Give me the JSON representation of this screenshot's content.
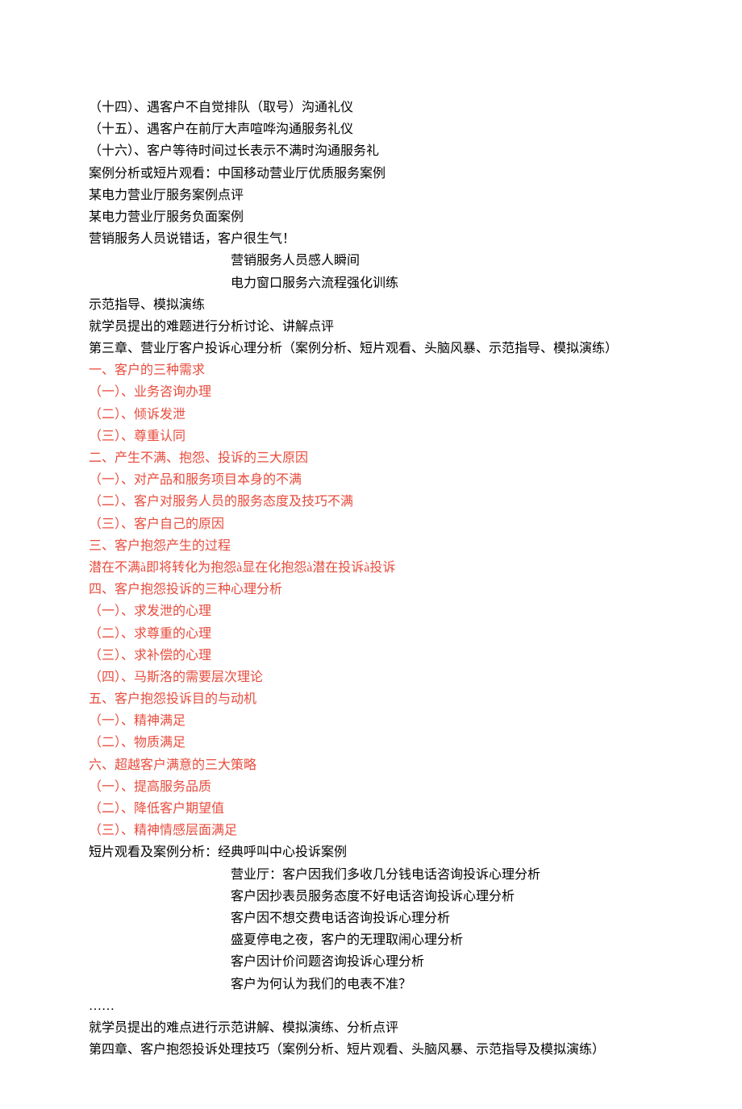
{
  "lines": [
    {
      "text": "（十四）、遇客户不自觉排队（取号）沟通礼仪",
      "color": "black"
    },
    {
      "text": "（十五）、遇客户在前厅大声喧哗沟通服务礼仪",
      "color": "black"
    },
    {
      "text": "（十六）、客户等待时间过长表示不满时沟通服务礼",
      "color": "black"
    },
    {
      "text": "案例分析或短片观看：中国移动营业厅优质服务案例",
      "color": "black"
    },
    {
      "text": "某电力营业厅服务案例点评",
      "color": "black"
    },
    {
      "text": "某电力营业厅服务负面案例",
      "color": "black"
    },
    {
      "text": "营销服务人员说错话，客户很生气！",
      "color": "black"
    },
    {
      "text": "营销服务人员感人瞬间",
      "color": "black",
      "indent": true
    },
    {
      "text": "电力窗口服务六流程强化训练",
      "color": "black",
      "indent": true
    },
    {
      "text": "示范指导、模拟演练",
      "color": "black"
    },
    {
      "text": "就学员提出的难题进行分析讨论、讲解点评",
      "color": "black"
    },
    {
      "text": "第三章、营业厅客户投诉心理分析（案例分析、短片观看、头脑风暴、示范指导、模拟演练）",
      "color": "black"
    },
    {
      "text": "一、客户的三种需求",
      "color": "red"
    },
    {
      "text": "（一）、业务咨询办理",
      "color": "red"
    },
    {
      "text": "（二）、倾诉发泄",
      "color": "red"
    },
    {
      "text": "（三）、尊重认同",
      "color": "red"
    },
    {
      "text": "二、产生不满、抱怨、投诉的三大原因",
      "color": "red"
    },
    {
      "text": "（一）、对产品和服务项目本身的不满",
      "color": "red"
    },
    {
      "text": "（二）、客户对服务人员的服务态度及技巧不满",
      "color": "red"
    },
    {
      "text": "（三）、客户自己的原因",
      "color": "red"
    },
    {
      "text": "三、客户抱怨产生的过程",
      "color": "red"
    },
    {
      "text": "潜在不满à即将转化为抱怨à显在化抱怨à潜在投诉à投诉",
      "color": "red"
    },
    {
      "text": "四、客户抱怨投诉的三种心理分析",
      "color": "red"
    },
    {
      "text": "（一）、求发泄的心理",
      "color": "red"
    },
    {
      "text": "（二）、求尊重的心理",
      "color": "red"
    },
    {
      "text": "（三）、求补偿的心理",
      "color": "red"
    },
    {
      "text": "（四）、马斯洛的需要层次理论",
      "color": "red"
    },
    {
      "text": "五、客户抱怨投诉目的与动机",
      "color": "red"
    },
    {
      "text": "（一）、精神满足",
      "color": "red"
    },
    {
      "text": "（二）、物质满足",
      "color": "red"
    },
    {
      "text": "六、超越客户满意的三大策略",
      "color": "red"
    },
    {
      "text": "（一）、提高服务品质",
      "color": "red"
    },
    {
      "text": "（二）、降低客户期望值",
      "color": "red"
    },
    {
      "text": "（三）、精神情感层面满足",
      "color": "red"
    },
    {
      "text": "短片观看及案例分析：经典呼叫中心投诉案例",
      "color": "black"
    },
    {
      "text": "营业厅：客户因我们多收几分钱电话咨询投诉心理分析",
      "color": "black",
      "indent": true
    },
    {
      "text": "客户因抄表员服务态度不好电话咨询投诉心理分析",
      "color": "black",
      "indent": true
    },
    {
      "text": "客户因不想交费电话咨询投诉心理分析",
      "color": "black",
      "indent": true
    },
    {
      "text": "盛夏停电之夜，客户的无理取闹心理分析",
      "color": "black",
      "indent": true
    },
    {
      "text": "客户因计价问题咨询投诉心理分析",
      "color": "black",
      "indent": true
    },
    {
      "text": "客户为何认为我们的电表不准？",
      "color": "black",
      "indent": true
    },
    {
      "text": "……",
      "color": "black"
    },
    {
      "text": "就学员提出的难点进行示范讲解、模拟演练、分析点评",
      "color": "black"
    },
    {
      "text": "第四章、客户抱怨投诉处理技巧（案例分析、短片观看、头脑风暴、示范指导及模拟演练）",
      "color": "black"
    }
  ]
}
